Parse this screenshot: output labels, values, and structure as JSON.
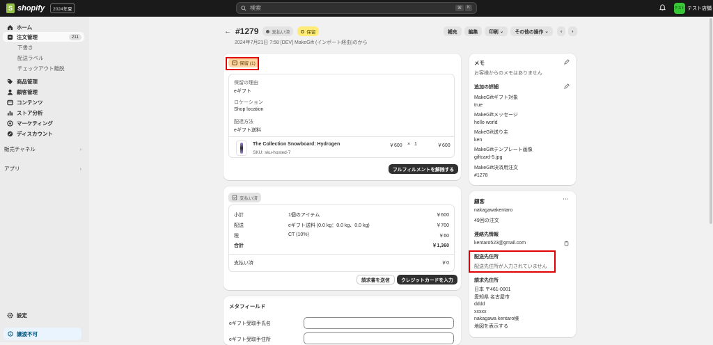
{
  "topbar": {
    "brand": "shopify",
    "version": "2024年夏",
    "search_placeholder": "検索",
    "shortcut": [
      "⌘",
      "K"
    ],
    "store_name": "テスト店舗",
    "store_avatar": "テスト"
  },
  "sidebar": {
    "items": [
      {
        "label": "ホーム",
        "icon": "home-icon"
      },
      {
        "label": "注文管理",
        "icon": "orders-icon",
        "count": "211"
      },
      {
        "label": "下書き"
      },
      {
        "label": "配送ラベル"
      },
      {
        "label": "チェックアウト離脱"
      },
      {
        "label": "商品管理",
        "icon": "tag-icon"
      },
      {
        "label": "顧客管理",
        "icon": "person-icon"
      },
      {
        "label": "コンテンツ",
        "icon": "content-icon"
      },
      {
        "label": "ストア分析",
        "icon": "analytics-icon"
      },
      {
        "label": "マーケティング",
        "icon": "target-icon"
      },
      {
        "label": "ディスカウント",
        "icon": "discount-icon"
      }
    ],
    "sales_channels": "販売チャネル",
    "apps": "アプリ",
    "settings": "設定",
    "notice": "譲渡不可"
  },
  "order": {
    "number": "#1279",
    "payment_status": "支払い済",
    "hold_status": "保留",
    "subtitle": "2024年7月21日 7:58 [DEV] MakeGift (インポート経由)のから",
    "actions": {
      "restock": "補充",
      "edit": "編集",
      "print": "印刷",
      "more": "その他の操作"
    }
  },
  "hold_card": {
    "tag": "保留 (1)",
    "reason_label": "保留の理由",
    "reason_value": "eギフト",
    "location_label": "ロケーション",
    "location_value": "Shop location",
    "shipping_label": "配達方法",
    "shipping_value": "eギフト送料",
    "product_name": "The Collection Snowboard: Hydrogen",
    "sku": "SKU: sku-hosted-7",
    "unit_price": "￥600",
    "times": "×",
    "qty": "1",
    "line_total": "￥600",
    "release_button": "フルフィルメントを解除する"
  },
  "payment_card": {
    "tag": "支払い済",
    "rows": [
      {
        "label": "小計",
        "desc": "1個のアイテム",
        "amount": "￥600"
      },
      {
        "label": "配送",
        "desc": "eギフト送料 (0.0 kg：0.0 kg、0.0 kg)",
        "amount": "￥700"
      },
      {
        "label": "税",
        "desc": "CT (10%)",
        "amount": "￥60"
      },
      {
        "label": "合計",
        "desc": "",
        "amount": "￥1,360"
      }
    ],
    "paid_label": "支払い済",
    "paid_amount": "￥0",
    "send_invoice": "請求書を送信",
    "enter_card": "クレジットカードを入力"
  },
  "metafields": {
    "title": "メタフィールド",
    "fields": [
      "eギフト受取手氏名",
      "eギフト受取手住所"
    ]
  },
  "notes": {
    "title": "メモ",
    "empty": "お客様からのメモはありません",
    "details_title": "追加の詳細",
    "details": [
      {
        "label": "MakeGiftギフト対象",
        "value": "true"
      },
      {
        "label": "MakeGiftメッセージ",
        "value": "hello world"
      },
      {
        "label": "MakeGift送り主",
        "value": "ken"
      },
      {
        "label": "MakeGiftテンプレート画像",
        "value": "giftcard-5.jpg"
      },
      {
        "label": "MakeGift決済用注文",
        "value": "#1278"
      }
    ]
  },
  "customer": {
    "title": "顧客",
    "name": "nakagawakentaro",
    "orders": "49回の注文",
    "contact_title": "連絡先情報",
    "email": "kentaro523@gmail.com",
    "shipping_title": "配送先住所",
    "shipping_empty": "配送先住所が入力されていません",
    "billing_title": "請求先住所",
    "billing_lines": [
      "日本 〒461-0001",
      "愛知県 名古屋市",
      "dddd",
      "xxxxx",
      "nakagawa kentaro様"
    ],
    "map_link": "地図を表示する"
  },
  "colors": {
    "highlight": "#e00000",
    "link": "#005bd3",
    "topbar": "#1a1a1a"
  }
}
